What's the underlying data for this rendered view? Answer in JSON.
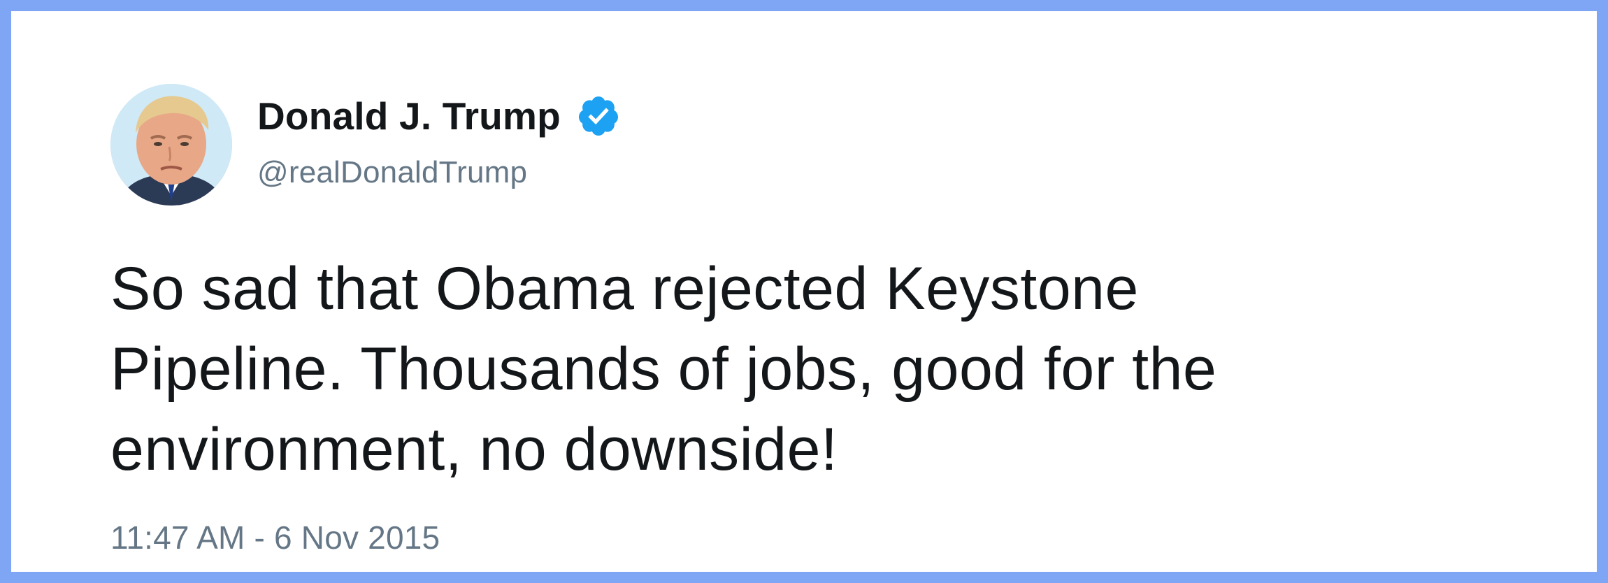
{
  "tweet": {
    "author": {
      "display_name": "Donald J. Trump",
      "handle": "@realDonaldTrump",
      "verified": true,
      "avatar_icon": "profile-photo-avatar",
      "verified_icon": "verified-badge-icon"
    },
    "text_lines": [
      "So sad that Obama rejected Keystone",
      "Pipeline. Thousands of jobs, good for the",
      "environment, no downside!"
    ],
    "timestamp": "11:47 AM - 6 Nov 2015"
  },
  "colors": {
    "frame_border": "#7fa6f5",
    "verified_blue": "#1da1f2",
    "primary_text": "#14171a",
    "secondary_text": "#657786",
    "background": "#ffffff"
  }
}
